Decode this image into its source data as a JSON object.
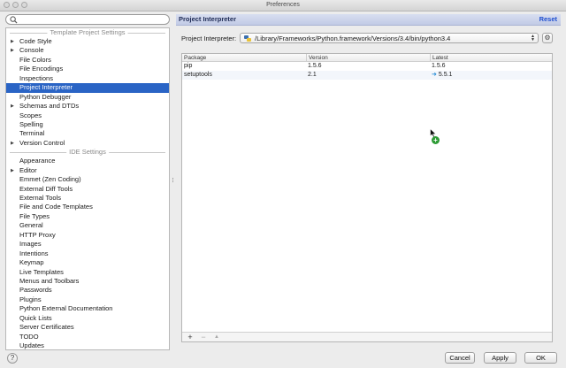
{
  "window": {
    "title": "Preferences"
  },
  "sidebar": {
    "search": {
      "value": "",
      "placeholder": ""
    },
    "sections": [
      {
        "title": "Template Project Settings",
        "items": [
          {
            "label": "Code Style",
            "expandable": true
          },
          {
            "label": "Console",
            "expandable": true
          },
          {
            "label": "File Colors",
            "expandable": false
          },
          {
            "label": "File Encodings",
            "expandable": false
          },
          {
            "label": "Inspections",
            "expandable": false
          },
          {
            "label": "Project Interpreter",
            "expandable": false,
            "selected": true
          },
          {
            "label": "Python Debugger",
            "expandable": false
          },
          {
            "label": "Schemas and DTDs",
            "expandable": true
          },
          {
            "label": "Scopes",
            "expandable": false
          },
          {
            "label": "Spelling",
            "expandable": false
          },
          {
            "label": "Terminal",
            "expandable": false
          },
          {
            "label": "Version Control",
            "expandable": true
          }
        ]
      },
      {
        "title": "IDE Settings",
        "items": [
          {
            "label": "Appearance",
            "expandable": false
          },
          {
            "label": "Editor",
            "expandable": true
          },
          {
            "label": "Emmet (Zen Coding)",
            "expandable": false
          },
          {
            "label": "External Diff Tools",
            "expandable": false
          },
          {
            "label": "External Tools",
            "expandable": false
          },
          {
            "label": "File and Code Templates",
            "expandable": false
          },
          {
            "label": "File Types",
            "expandable": false
          },
          {
            "label": "General",
            "expandable": false
          },
          {
            "label": "HTTP Proxy",
            "expandable": false
          },
          {
            "label": "Images",
            "expandable": false
          },
          {
            "label": "Intentions",
            "expandable": false
          },
          {
            "label": "Keymap",
            "expandable": false
          },
          {
            "label": "Live Templates",
            "expandable": false
          },
          {
            "label": "Menus and Toolbars",
            "expandable": false
          },
          {
            "label": "Passwords",
            "expandable": false
          },
          {
            "label": "Plugins",
            "expandable": false
          },
          {
            "label": "Python External Documentation",
            "expandable": false
          },
          {
            "label": "Quick Lists",
            "expandable": false
          },
          {
            "label": "Server Certificates",
            "expandable": false
          },
          {
            "label": "TODO",
            "expandable": false
          },
          {
            "label": "Updates",
            "expandable": false
          }
        ]
      }
    ]
  },
  "panel": {
    "title": "Project Interpreter",
    "reset_label": "Reset",
    "interpreter_label": "Project Interpreter:",
    "interpreter_path": "/Library/Frameworks/Python.framework/Versions/3.4/bin/python3.4"
  },
  "packages": {
    "columns": [
      "Package",
      "Version",
      "Latest"
    ],
    "rows": [
      {
        "package": "pip",
        "version": "1.5.6",
        "latest": "1.5.6",
        "update_available": false
      },
      {
        "package": "setuptools",
        "version": "2.1",
        "latest": "5.5.1",
        "update_available": true
      }
    ],
    "toolbar": {
      "add": "+",
      "remove": "−",
      "upgrade": "▲"
    }
  },
  "footer": {
    "help": "?",
    "cancel": "Cancel",
    "apply": "Apply",
    "ok": "OK"
  },
  "colors": {
    "selection": "#2a64c5",
    "reset_link": "#1f4fd0",
    "update_arrow": "#2a8fd8",
    "drag_add_badge": "#2d9b35"
  },
  "icons": {
    "search": "search-icon",
    "interpreter": "python-icon",
    "settings": "gear-icon",
    "update": "arrow-right-icon",
    "cursor": "mouse-pointer-icon",
    "drag_add": "plus-icon"
  }
}
